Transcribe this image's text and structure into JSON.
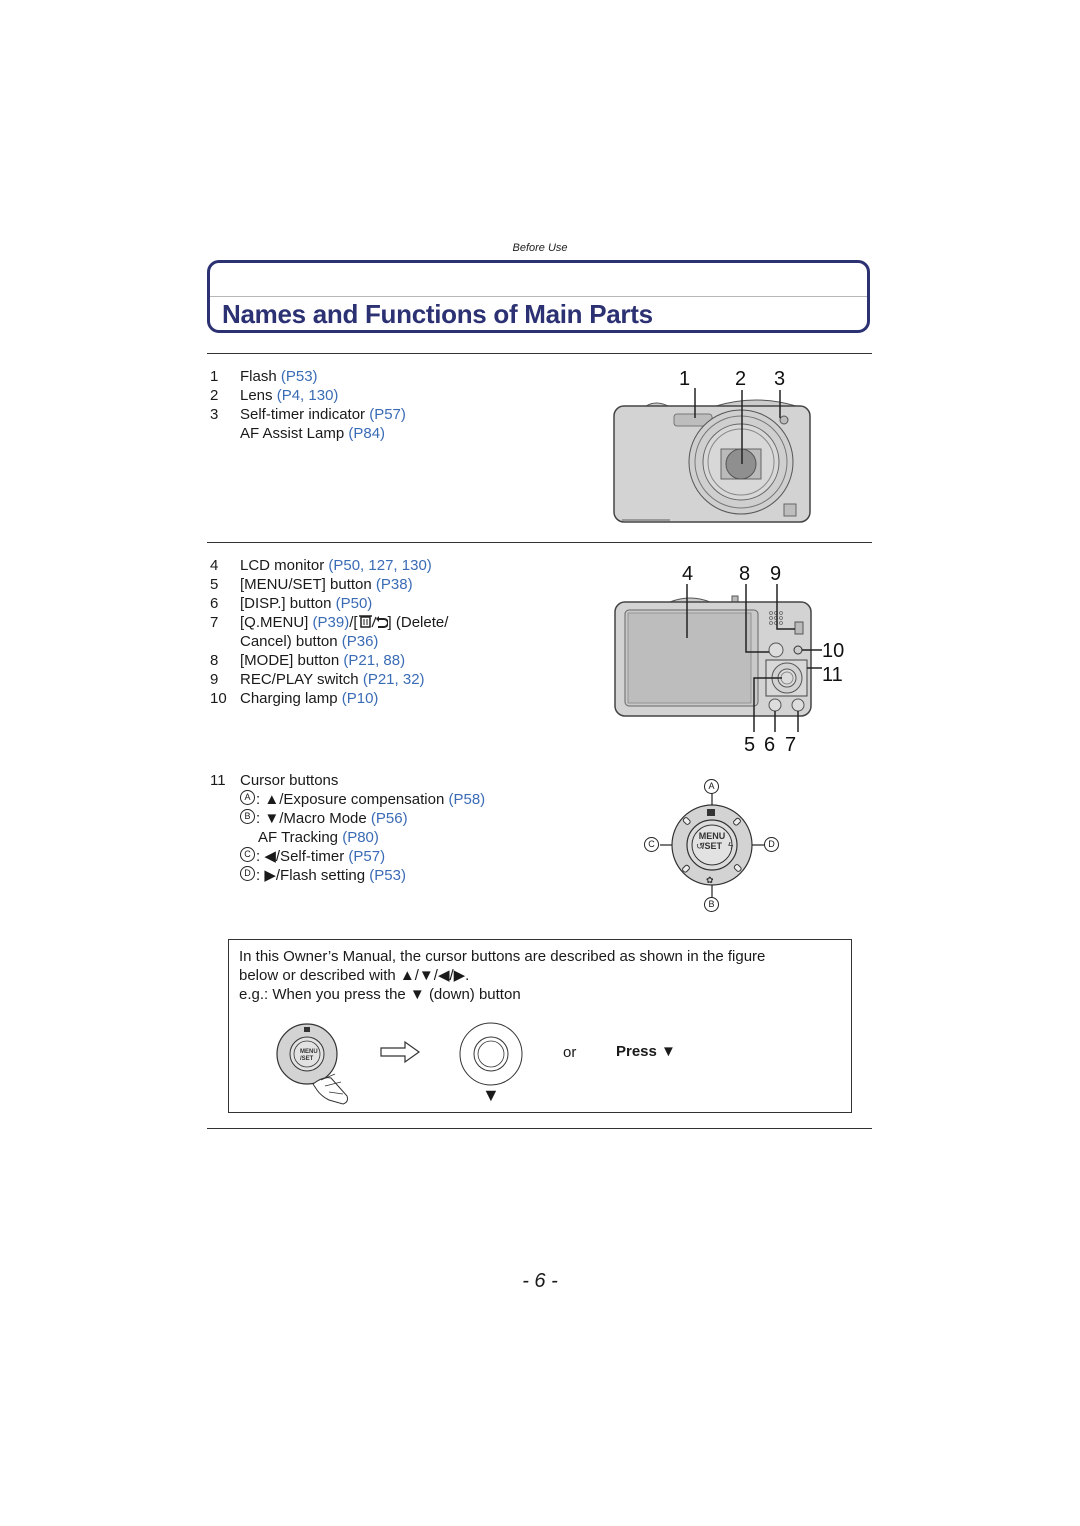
{
  "header": {
    "section": "Before Use",
    "title": "Names and Functions of Main Parts"
  },
  "front_parts": [
    {
      "num": "1",
      "label": "Flash",
      "ref": "(P53)"
    },
    {
      "num": "2",
      "label": "Lens",
      "ref": "(P4, 130)"
    },
    {
      "num": "3",
      "label": "Self-timer indicator",
      "ref": "(P57)"
    },
    {
      "num": "",
      "label": "AF Assist Lamp",
      "ref": "(P84)"
    }
  ],
  "front_callouts": [
    "1",
    "2",
    "3"
  ],
  "rear_parts": [
    {
      "num": "4",
      "label": "LCD monitor",
      "ref": "(P50, 127, 130)"
    },
    {
      "num": "5",
      "label": "[MENU/SET] button",
      "ref": "(P38)"
    },
    {
      "num": "6",
      "label": "[DISP.] button",
      "ref": "(P50)"
    },
    {
      "num": "7",
      "label": "[Q.MENU]",
      "ref": "(P39)",
      "label2": "/[",
      "label3": "] (Delete/"
    },
    {
      "num": "",
      "label": "Cancel) button",
      "ref": "(P36)"
    },
    {
      "num": "8",
      "label": "[MODE] button",
      "ref": "(P21, 88)"
    },
    {
      "num": "9",
      "label": "REC/PLAY switch",
      "ref": "(P21, 32)"
    },
    {
      "num": "10",
      "label": "Charging lamp",
      "ref": "(P10)"
    }
  ],
  "rear_callouts": {
    "top": [
      "4",
      "8",
      "9"
    ],
    "right": [
      "10",
      "11"
    ],
    "bottom": [
      "5",
      "6",
      "7"
    ]
  },
  "cursor": {
    "num": "11",
    "title": "Cursor buttons",
    "items": [
      {
        "key": "A",
        "arrow": "▲",
        "label": "/Exposure compensation",
        "ref": "(P58)"
      },
      {
        "key": "B",
        "arrow": "▼",
        "label": "/Macro Mode",
        "ref": "(P56)"
      },
      {
        "key": "",
        "arrow": "",
        "label": "AF Tracking",
        "ref": "(P80)"
      },
      {
        "key": "C",
        "arrow": "◀",
        "label": "/Self-timer",
        "ref": "(P57)"
      },
      {
        "key": "D",
        "arrow": "▶",
        "label": "/Flash setting",
        "ref": "(P53)"
      }
    ],
    "dial": {
      "center": [
        "MENU",
        "/SET"
      ],
      "keys": [
        "A",
        "B",
        "C",
        "D"
      ]
    }
  },
  "note": {
    "line1": "In this Owner’s Manual, the cursor buttons are described as shown in the figure",
    "line2": "below or described with ▲/▼/◀/▶.",
    "line3": "e.g.: When you press the ▼ (down) button",
    "or_label": "or",
    "press_label": "Press ▼",
    "down_arrow": "▼"
  },
  "footer": {
    "page": "- 6 -"
  },
  "colors": {
    "title": "#2b3172",
    "reference": "#3a6bb5"
  }
}
